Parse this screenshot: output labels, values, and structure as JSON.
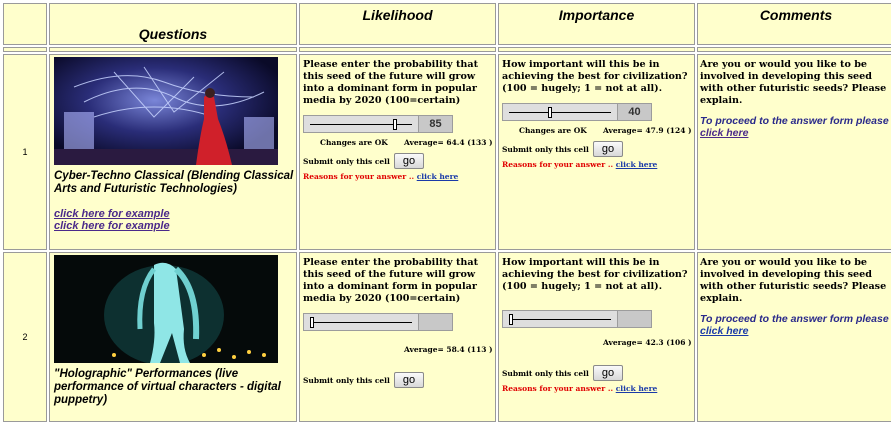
{
  "headers": {
    "questions": "Questions",
    "likelihood": "Likelihood",
    "importance": "Importance",
    "comments": "Comments"
  },
  "rows": [
    {
      "number": "1",
      "title": "Cyber-Techno Classical (Blending Classical Arts and Futuristic Technologies)",
      "links": [
        "click here for example",
        "click here for example"
      ],
      "likelihood": {
        "prompt": "Please enter the probability that this seed of the future will grow into a dominant form in popular media by 2020 (100=certain)",
        "value": "85",
        "level": 0.85,
        "changes": "Changes are OK",
        "average": "Average= 64.4 (133 )",
        "submit_label": "Submit only this cell",
        "go": "go",
        "reasons": "Reasons for your answer .. ",
        "reasons_link": "click here"
      },
      "importance": {
        "prompt": "How important will this be in achieving the best for civilization? (100 = hugely; 1 = not at all).",
        "value": "40",
        "level": 0.4,
        "changes": "Changes are OK",
        "average": "Average= 47.9 (124 )",
        "submit_label": "Submit only this cell",
        "go": "go",
        "reasons": "Reasons for your answer .. ",
        "reasons_link": "click here"
      },
      "comments": {
        "prompt": "Are you or would you like to be involved in developing this seed with other futuristic seeds? Please explain.",
        "proceed": "To proceed to the answer form please ",
        "proceed_link": "click here"
      }
    },
    {
      "number": "2",
      "title": "\"Holographic\" Performances (live performance of virtual characters - digital puppetry)",
      "likelihood": {
        "prompt": "Please enter the probability that this seed of the future will grow into a dominant form in popular media by 2020 (100=certain)",
        "value": "",
        "level": 0.0,
        "average": "Average= 58.4 (113 )",
        "submit_label": "Submit only this cell",
        "go": "go"
      },
      "importance": {
        "prompt": "How important will this be in achieving the best for civilization? (100 = hugely; 1 = not at all).",
        "value": "",
        "level": 0.0,
        "average": "Average= 42.3 (106 )",
        "submit_label": "Submit only this cell",
        "go": "go",
        "reasons": "Reasons for your answer .. ",
        "reasons_link": "click here"
      },
      "comments": {
        "prompt": "Are you or would you like to be involved in developing this seed with other futuristic seeds? Please explain.",
        "proceed": "To proceed to the answer form please ",
        "proceed_link": "click here"
      }
    }
  ]
}
